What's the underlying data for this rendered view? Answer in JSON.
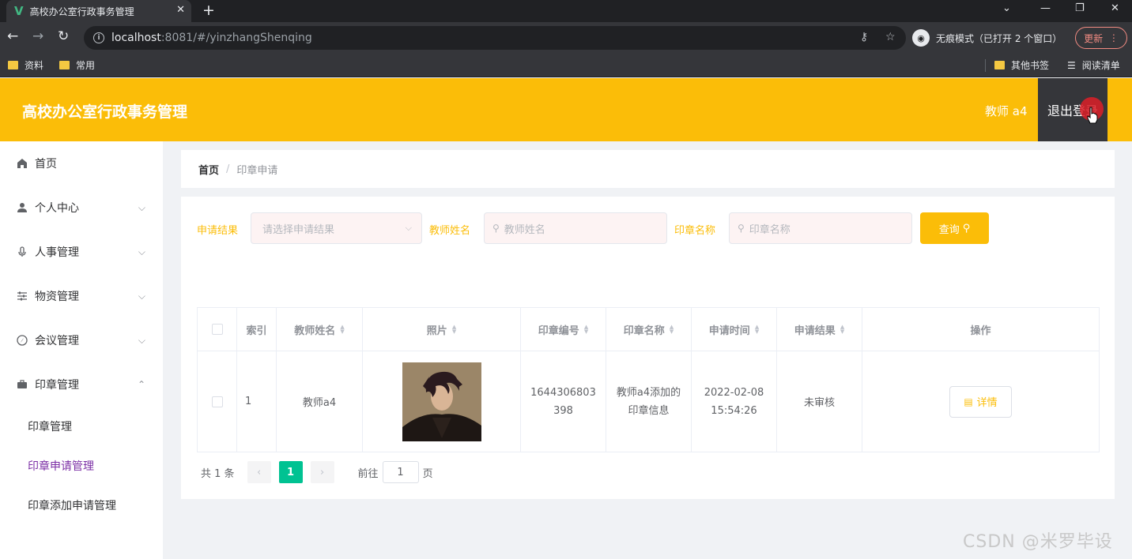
{
  "browser": {
    "tab_title": "高校办公室行政事务管理",
    "new_tab": "+",
    "url_host": "localhost",
    "url_path": ":8081/#/yinzhangShenqing",
    "incognito_label": "无痕模式（已打开 2 个窗口）",
    "update_label": "更新",
    "bookmarks": [
      "资料",
      "常用"
    ],
    "bookmarks_right": [
      "其他书签",
      "阅读清单"
    ]
  },
  "header": {
    "title": "高校办公室行政事务管理",
    "username": "教师 a4",
    "logout": "退出登录"
  },
  "sidebar": {
    "items": [
      {
        "label": "首页",
        "icon": "home-icon"
      },
      {
        "label": "个人中心",
        "icon": "user-icon"
      },
      {
        "label": "人事管理",
        "icon": "microphone-icon"
      },
      {
        "label": "物资管理",
        "icon": "sliders-icon"
      },
      {
        "label": "会议管理",
        "icon": "compass-icon"
      },
      {
        "label": "印章管理",
        "icon": "briefcase-icon"
      }
    ],
    "subitems": [
      "印章管理",
      "印章申请管理",
      "印章添加申请管理"
    ],
    "active_sub": "印章申请管理"
  },
  "breadcrumb": {
    "home": "首页",
    "sep": "/",
    "current": "印章申请"
  },
  "filters": {
    "result_label": "申请结果",
    "result_placeholder": "请选择申请结果",
    "teacher_label": "教师姓名",
    "teacher_placeholder": "教师姓名",
    "seal_label": "印章名称",
    "seal_placeholder": "印章名称",
    "query_button": "查询"
  },
  "table": {
    "headers": [
      "索引",
      "教师姓名",
      "照片",
      "印章编号",
      "印章名称",
      "申请时间",
      "申请结果",
      "操作"
    ],
    "rows": [
      {
        "index": "1",
        "teacher": "教师a4",
        "seal_no_1": "1644306803",
        "seal_no_2": "398",
        "seal_name_1": "教师a4添加的",
        "seal_name_2": "印章信息",
        "time_1": "2022-02-08",
        "time_2": "15:54:26",
        "result": "未审核",
        "action": "详情"
      }
    ]
  },
  "pagination": {
    "total": "共 1 条",
    "current": "1",
    "goto_label": "前往",
    "goto_value": "1",
    "page_suffix": "页"
  },
  "watermark": "CSDN @米罗毕设",
  "colors": {
    "accent": "#fbbd08",
    "active_menu": "#7b2ea5",
    "page_active": "#00c292"
  }
}
